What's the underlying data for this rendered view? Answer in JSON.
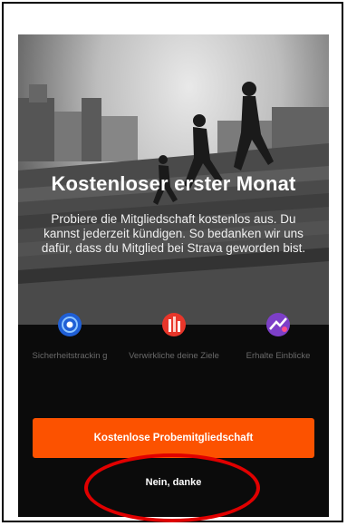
{
  "hero": {
    "title": "Kostenloser erster Monat",
    "subtitle": "Probiere die Mitgliedschaft kostenlos aus. Du kannst jederzeit kündigen. So bedanken wir uns dafür, dass du Mitglied bei Strava geworden bist."
  },
  "features": [
    {
      "icon": "safety-tracking-icon",
      "label": "Sicherheitstrackin g"
    },
    {
      "icon": "goals-icon",
      "label": "Verwirkliche deine Ziele"
    },
    {
      "icon": "insights-icon",
      "label": "Erhalte Einblicke"
    }
  ],
  "actions": {
    "trial_label": "Kostenlose Probemitgliedschaft",
    "decline_label": "Nein, danke"
  },
  "colors": {
    "accent": "#fc5200",
    "annotation": "#e10000",
    "background": "#0b0b0b"
  }
}
